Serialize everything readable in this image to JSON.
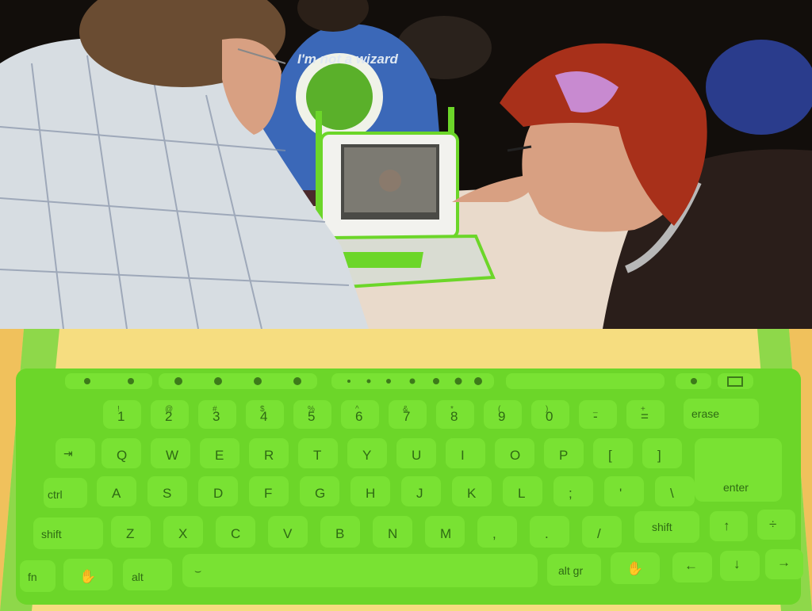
{
  "scene": {
    "top_caption": "",
    "bottom_caption": ""
  },
  "shirt": {
    "text": "I'm not a wizard",
    "right_text": "wizard"
  },
  "keyboard": {
    "row1": [
      {
        "main": "1",
        "sub": "!"
      },
      {
        "main": "2",
        "sub": "@"
      },
      {
        "main": "3",
        "sub": "#"
      },
      {
        "main": "4",
        "sub": "$"
      },
      {
        "main": "5",
        "sub": "%"
      },
      {
        "main": "6",
        "sub": "^"
      },
      {
        "main": "7",
        "sub": "&"
      },
      {
        "main": "8",
        "sub": "*"
      },
      {
        "main": "9",
        "sub": "("
      },
      {
        "main": "0",
        "sub": ")"
      },
      {
        "main": "-",
        "sub": "_"
      },
      {
        "main": "=",
        "sub": "+"
      }
    ],
    "erase": "erase",
    "row2": [
      "Q",
      "W",
      "E",
      "R",
      "T",
      "Y",
      "U",
      "I",
      "O",
      "P",
      "[",
      "]"
    ],
    "row3": [
      "A",
      "S",
      "D",
      "F",
      "G",
      "H",
      "J",
      "K",
      "L",
      ";",
      "'",
      "\\"
    ],
    "enter": "enter",
    "row4": [
      "Z",
      "X",
      "C",
      "V",
      "B",
      "N",
      "M",
      ",",
      ".",
      "/"
    ],
    "shift_left": "shift",
    "shift_right": "shift",
    "fn": "fn",
    "ctrl": "ctrl",
    "alt": "alt",
    "alt_gr": "alt gr",
    "colors": {
      "rubber": "#6cd629",
      "rubber_dark": "#4fae1a",
      "frame": "#f4d977",
      "bezel": "#8ed84a"
    }
  }
}
